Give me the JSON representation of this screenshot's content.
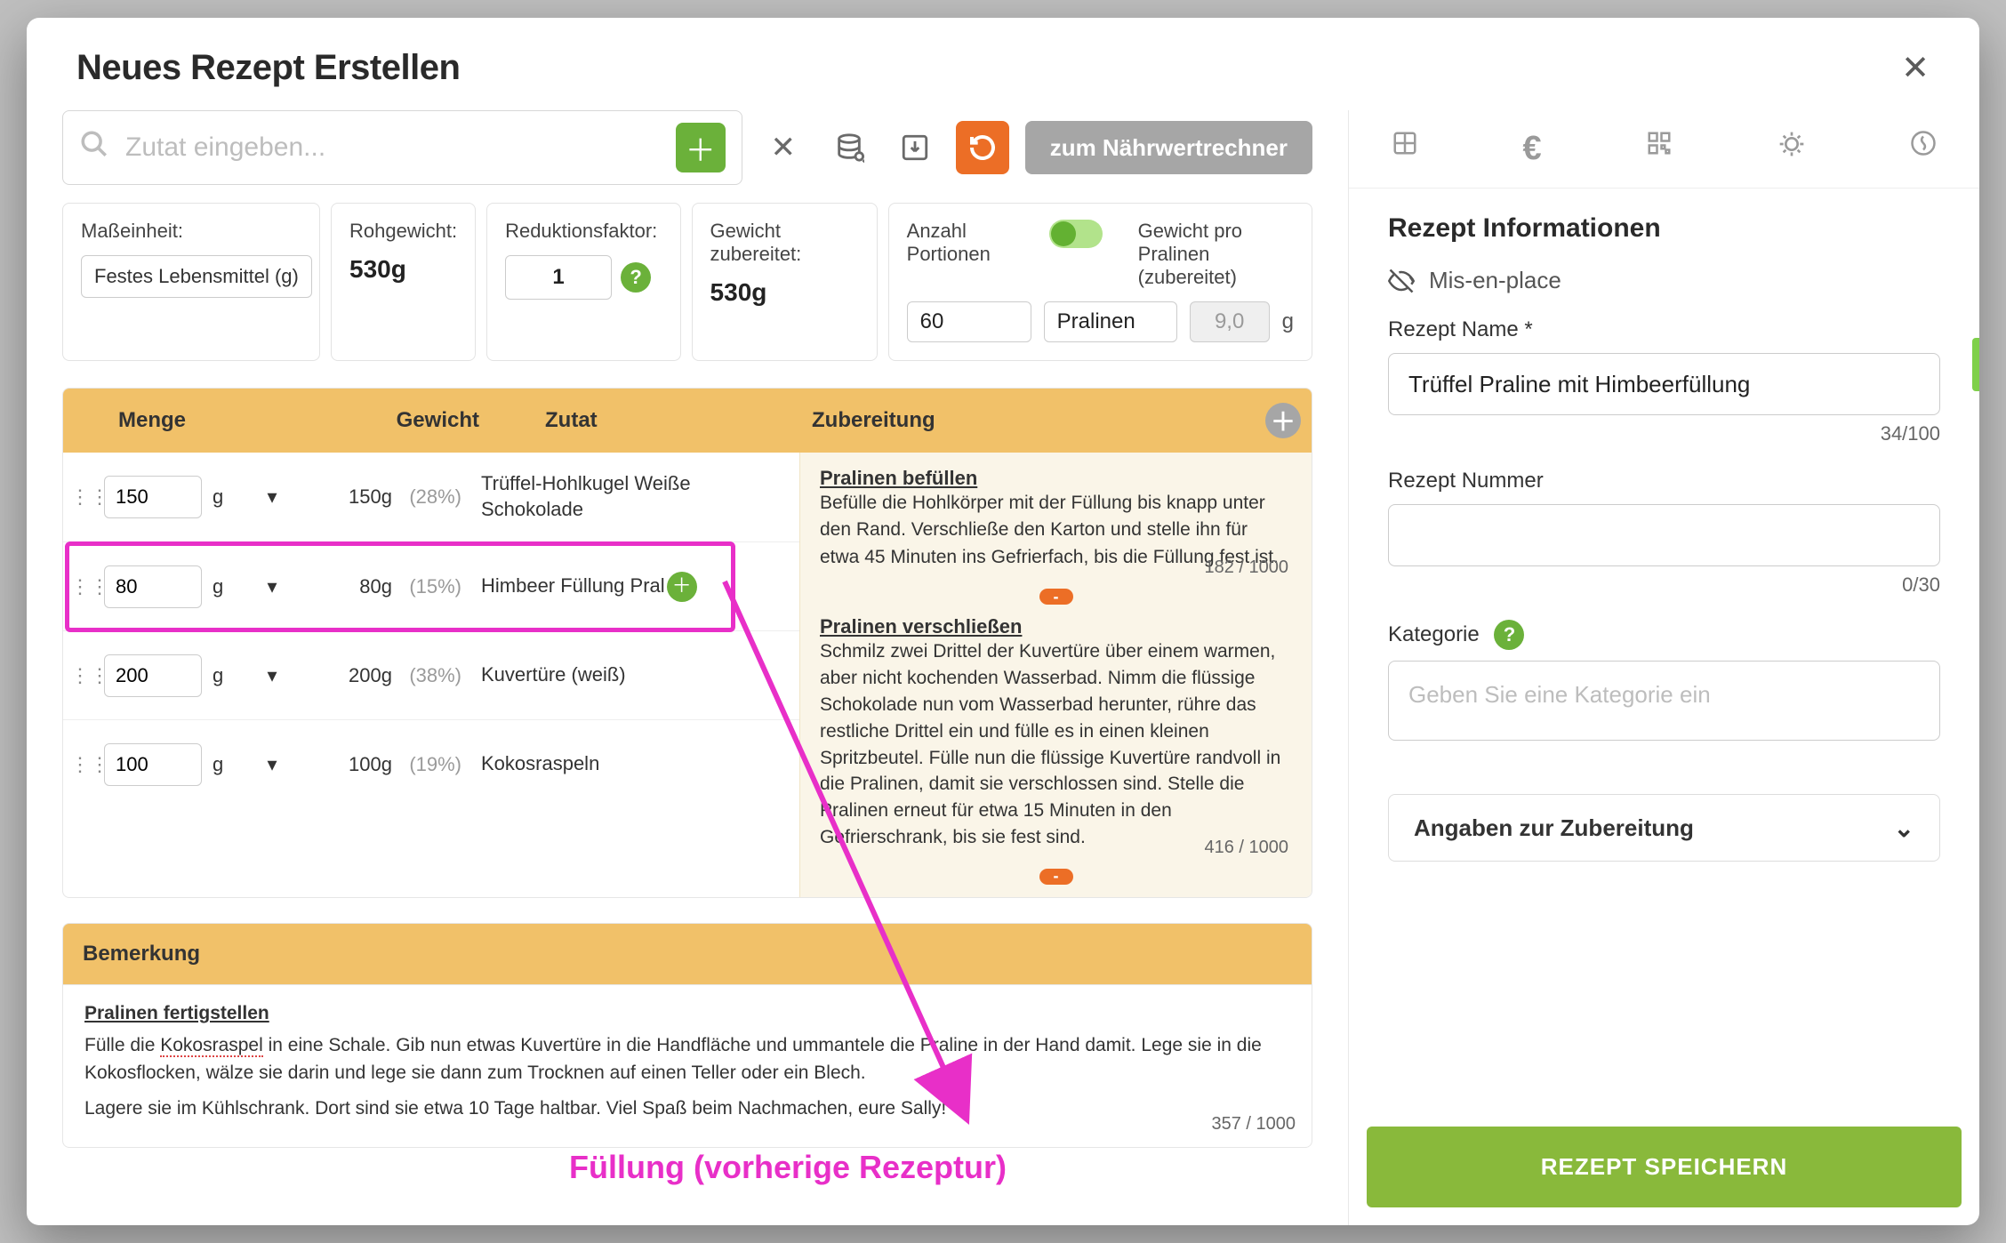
{
  "modal": {
    "title": "Neues Rezept Erstellen"
  },
  "search": {
    "placeholder": "Zutat eingeben..."
  },
  "toolbar": {
    "nutrition_btn": "zum Nährwertrechner"
  },
  "params": {
    "unit_label": "Maßeinheit:",
    "unit_value": "Festes Lebensmittel (g)",
    "raw_label": "Rohgewicht:",
    "raw_value": "530g",
    "reduction_label": "Reduktionsfaktor:",
    "reduction_value": "1",
    "prepared_label": "Gewicht zubereitet:",
    "prepared_value": "530g",
    "portions_label": "Anzahl Portionen",
    "portions_value": "60",
    "portions_unit": "Pralinen",
    "per_portion_label": "Gewicht pro Pralinen (zubereitet)",
    "per_portion_value": "9,0",
    "per_portion_unit": "g"
  },
  "table": {
    "col_menge": "Menge",
    "col_gewicht": "Gewicht",
    "col_zutat": "Zutat",
    "col_zubereitung": "Zubereitung",
    "rows": [
      {
        "qty": "150",
        "unit": "g",
        "weight": "150g",
        "pct": "(28%)",
        "name": "Trüffel-Hohlkugel Weiße Schokolade"
      },
      {
        "qty": "80",
        "unit": "g",
        "weight": "80g",
        "pct": "(15%)",
        "name": "Himbeer Füllung Pral"
      },
      {
        "qty": "200",
        "unit": "g",
        "weight": "200g",
        "pct": "(38%)",
        "name": "Kuvertüre (weiß)"
      },
      {
        "qty": "100",
        "unit": "g",
        "weight": "100g",
        "pct": "(19%)",
        "name": "Kokosraspeln"
      }
    ]
  },
  "prep": {
    "b1_title": "Pralinen befüllen",
    "b1_text": "Befülle die Hohlkörper mit der Füllung bis knapp unter den Rand. Verschließe den Karton und stelle ihn für etwa 45 Minuten ins Gefrierfach, bis die Füllung fest ist.",
    "b1_count": "182 / 1000",
    "b2_title": "Pralinen verschließen",
    "b2_text": "Schmilz zwei Drittel der Kuvertüre über einem warmen, aber nicht kochenden Wasserbad. Nimm die flüssige Schokolade nun vom Wasserbad herunter, rühre das restliche Drittel ein und fülle es in einen kleinen Spritzbeutel. Fülle nun die flüssige Kuvertüre randvoll in die Pralinen, damit sie verschlossen sind. Stelle die Pralinen erneut für etwa 15 Minuten in den Gefrierschrank, bis sie fest sind.",
    "b2_count": "416 / 1000"
  },
  "bem": {
    "heading": "Bemerkung",
    "title": "Pralinen fertigstellen",
    "p1a": "Fülle die ",
    "p1_dotted": "Kokosraspel",
    "p1b": " in eine Schale. Gib nun etwas Kuvertüre in die Handfläche und ummantele die Praline in der Hand damit. Lege sie in die Kokosflocken, wälze sie darin und lege sie dann zum Trocknen auf einen Teller oder ein Blech.",
    "p2": "Lagere sie im Kühlschrank. Dort sind sie etwa 10 Tage haltbar. Viel Spaß beim Nachmachen, eure Sally!",
    "count": "357 / 1000"
  },
  "right": {
    "heading": "Rezept Informationen",
    "mep": "Mis-en-place",
    "name_label": "Rezept Name *",
    "name_value": "Trüffel Praline mit Himbeerfüllung",
    "name_count": "34/100",
    "num_label": "Rezept Nummer",
    "num_count": "0/30",
    "cat_label": "Kategorie",
    "cat_placeholder": "Geben Sie eine Kategorie ein",
    "accordion": "Angaben zur Zubereitung",
    "save": "REZEPT SPEICHERN"
  },
  "annotation": {
    "text": "Füllung (vorherige Rezeptur)"
  }
}
